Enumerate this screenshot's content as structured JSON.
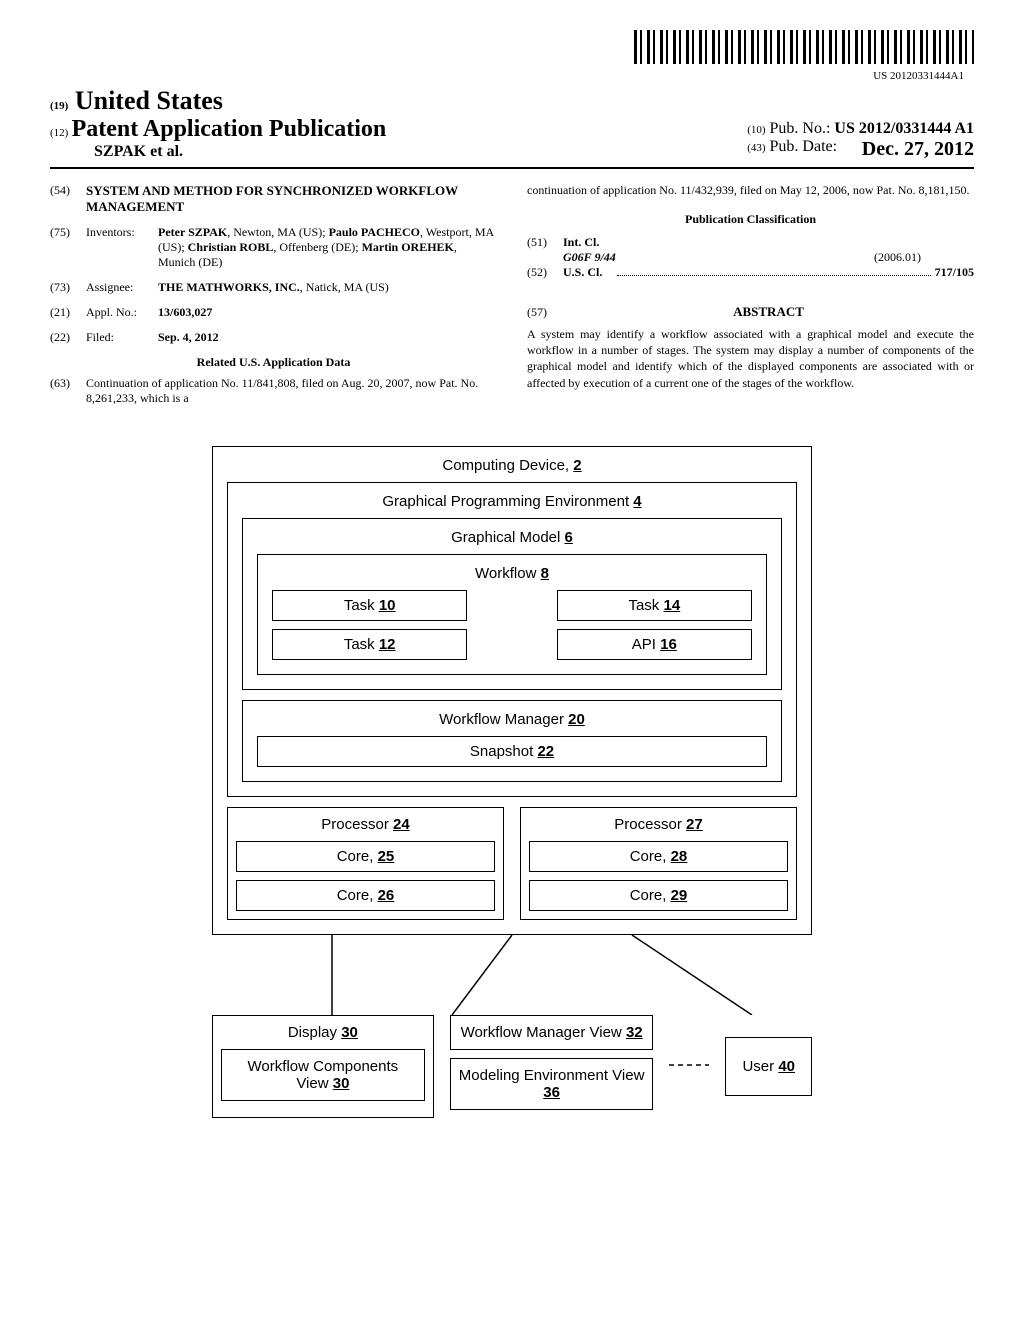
{
  "barcode_number": "US 20120331444A1",
  "header": {
    "country_code": "(19)",
    "country": "United States",
    "doc_type_code": "(12)",
    "doc_type": "Patent Application Publication",
    "authors_line": "SZPAK et al.",
    "pub_no_code": "(10)",
    "pub_no_label": "Pub. No.:",
    "pub_no": "US 2012/0331444 A1",
    "pub_date_code": "(43)",
    "pub_date_label": "Pub. Date:",
    "pub_date": "Dec. 27, 2012"
  },
  "left_col": {
    "title_code": "(54)",
    "title": "SYSTEM AND METHOD FOR SYNCHRONIZED WORKFLOW MANAGEMENT",
    "inventors_code": "(75)",
    "inventors_label": "Inventors:",
    "inventors": "Peter SZPAK, Newton, MA (US); Paulo PACHECO, Westport, MA (US); Christian ROBL, Offenberg (DE); Martin OREHEK, Munich (DE)",
    "assignee_code": "(73)",
    "assignee_label": "Assignee:",
    "assignee": "THE MATHWORKS, INC., Natick, MA (US)",
    "appl_code": "(21)",
    "appl_label": "Appl. No.:",
    "appl_no": "13/603,027",
    "filed_code": "(22)",
    "filed_label": "Filed:",
    "filed": "Sep. 4, 2012",
    "related_header": "Related U.S. Application Data",
    "cont_code": "(63)",
    "cont_text": "Continuation of application No. 11/841,808, filed on Aug. 20, 2007, now Pat. No. 8,261,233, which is a"
  },
  "right_col": {
    "cont_continued": "continuation of application No. 11/432,939, filed on May 12, 2006, now Pat. No. 8,181,150.",
    "class_header": "Publication Classification",
    "intcl_code": "(51)",
    "intcl_label": "Int. Cl.",
    "intcl_code_val": "G06F 9/44",
    "intcl_date": "(2006.01)",
    "uscl_code": "(52)",
    "uscl_label": "U.S. Cl.",
    "uscl_val": "717/105",
    "abstract_code": "(57)",
    "abstract_label": "ABSTRACT",
    "abstract_text": "A system may identify a workflow associated with a graphical model and execute the workflow in a number of stages. The system may display a number of components of the graphical model and identify which of the displayed components are associated with or affected by execution of a current one of the stages of the workflow."
  },
  "diagram": {
    "device": "Computing Device,",
    "device_ref": "2",
    "env": "Graphical Programming Environment",
    "env_ref": "4",
    "model": "Graphical Model",
    "model_ref": "6",
    "workflow": "Workflow",
    "workflow_ref": "8",
    "task10": "Task",
    "task10_ref": "10",
    "task12": "Task",
    "task12_ref": "12",
    "task14": "Task",
    "task14_ref": "14",
    "api": "API",
    "api_ref": "16",
    "wfm": "Workflow Manager",
    "wfm_ref": "20",
    "snapshot": "Snapshot",
    "snapshot_ref": "22",
    "proc24": "Processor",
    "proc24_ref": "24",
    "core25": "Core,",
    "core25_ref": "25",
    "core26": "Core,",
    "core26_ref": "26",
    "proc27": "Processor",
    "proc27_ref": "27",
    "core28": "Core,",
    "core28_ref": "28",
    "core29": "Core,",
    "core29_ref": "29",
    "display": "Display",
    "display_ref": "30",
    "wcv": "Workflow Components View",
    "wcv_ref": "30",
    "wmv": "Workflow Manager View",
    "wmv_ref": "32",
    "mev": "Modeling Environment View",
    "mev_ref": "36",
    "user": "User",
    "user_ref": "40"
  }
}
